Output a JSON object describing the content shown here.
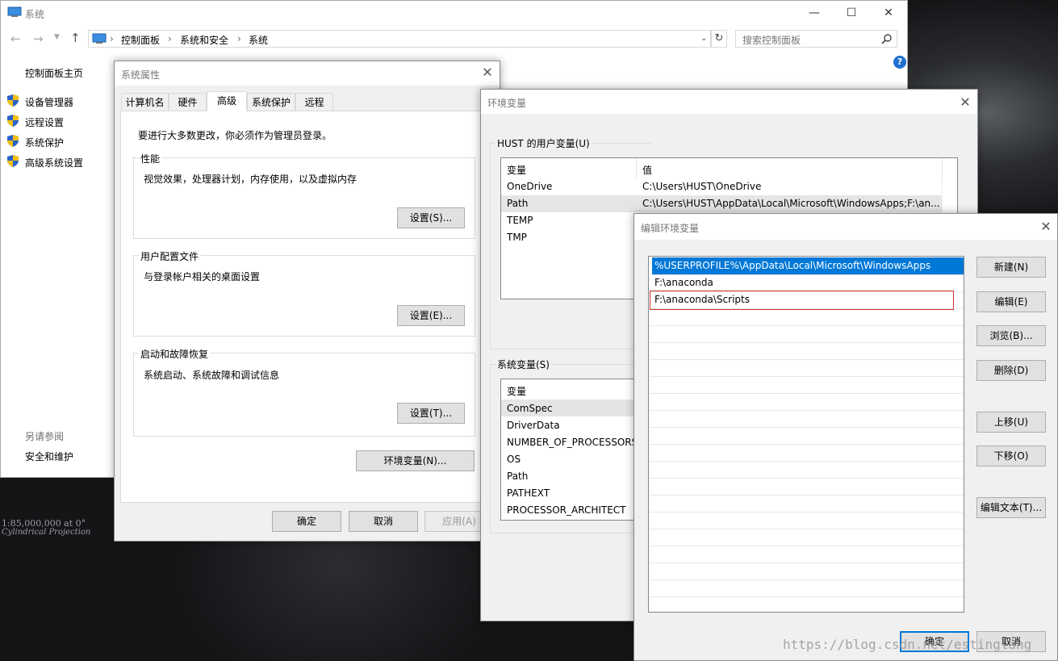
{
  "main_window": {
    "title": "系统",
    "breadcrumb": [
      "控制面板",
      "系统和安全",
      "系统"
    ],
    "search_placeholder": "搜索控制面板",
    "sidebar": {
      "home": "控制面板主页",
      "items": [
        "设备管理器",
        "远程设置",
        "系统保护",
        "高级系统设置"
      ],
      "see_also_header": "另请参阅",
      "see_also_items": [
        "安全和维护"
      ]
    }
  },
  "system_properties": {
    "title": "系统属性",
    "tabs": [
      "计算机名",
      "硬件",
      "高级",
      "系统保护",
      "远程"
    ],
    "selected_tab": "高级",
    "admin_note": "要进行大多数更改，你必须作为管理员登录。",
    "performance": {
      "label": "性能",
      "desc": "视觉效果，处理器计划，内存使用，以及虚拟内存",
      "button": "设置(S)..."
    },
    "user_profiles": {
      "label": "用户配置文件",
      "desc": "与登录帐户相关的桌面设置",
      "button": "设置(E)..."
    },
    "startup": {
      "label": "启动和故障恢复",
      "desc": "系统启动、系统故障和调试信息",
      "button": "设置(T)..."
    },
    "env_button": "环境变量(N)...",
    "ok": "确定",
    "cancel": "取消",
    "apply": "应用(A)"
  },
  "env_vars": {
    "title": "环境变量",
    "user_group": "HUST 的用户变量(U)",
    "col_var": "变量",
    "col_val": "值",
    "user_vars": [
      {
        "name": "OneDrive",
        "value": "C:\\Users\\HUST\\OneDrive"
      },
      {
        "name": "Path",
        "value": "C:\\Users\\HUST\\AppData\\Local\\Microsoft\\WindowsApps;F:\\an..."
      },
      {
        "name": "TEMP",
        "value": ""
      },
      {
        "name": "TMP",
        "value": ""
      }
    ],
    "system_group": "系统变量(S)",
    "system_vars": [
      "ComSpec",
      "DriverData",
      "NUMBER_OF_PROCESSORS",
      "OS",
      "Path",
      "PATHEXT",
      "PROCESSOR_ARCHITECT"
    ]
  },
  "edit_env": {
    "title": "编辑环境变量",
    "entries": [
      "%USERPROFILE%\\AppData\\Local\\Microsoft\\WindowsApps",
      "F:\\anaconda",
      "F:\\anaconda\\Scripts"
    ],
    "selected_index": 0,
    "highlight_index": 2,
    "buttons": {
      "new": "新建(N)",
      "edit": "编辑(E)",
      "browse": "浏览(B)...",
      "delete": "删除(D)",
      "up": "上移(U)",
      "down": "下移(O)",
      "edit_text": "编辑文本(T)..."
    },
    "ok": "确定",
    "cancel": "取消"
  },
  "wallpaper": {
    "scale": "1:85,000,000 at 0°",
    "projection": "Cylindrical Projection"
  },
  "watermark": "https://blog.csdn.net/estinglang",
  "colors": {
    "accent": "#0078d7",
    "highlight_border": "#d0312d",
    "selection_bg": "#0078d7"
  }
}
